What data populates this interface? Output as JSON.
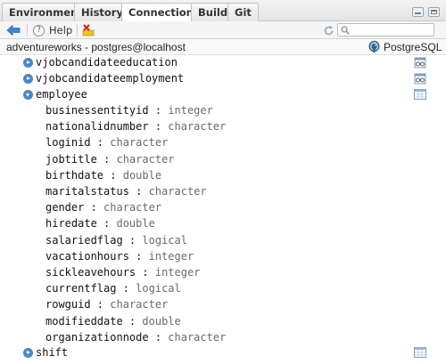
{
  "tabs": [
    "Environment",
    "History",
    "Connections",
    "Build",
    "Git"
  ],
  "toolbar": {
    "help_label": "Help",
    "search_placeholder": ""
  },
  "connection": {
    "title": "adventureworks - postgres@localhost",
    "db_label": "PostgreSQL"
  },
  "tree": {
    "views": [
      "vjobcandidateeducation",
      "vjobcandidateemployment"
    ],
    "expanded_table": "employee",
    "fields": [
      {
        "name": "businessentityid",
        "type": "integer"
      },
      {
        "name": "nationalidnumber",
        "type": "character"
      },
      {
        "name": "loginid",
        "type": "character"
      },
      {
        "name": "jobtitle",
        "type": "character"
      },
      {
        "name": "birthdate",
        "type": "double"
      },
      {
        "name": "maritalstatus",
        "type": "character"
      },
      {
        "name": "gender",
        "type": "character"
      },
      {
        "name": "hiredate",
        "type": "double"
      },
      {
        "name": "salariedflag",
        "type": "logical"
      },
      {
        "name": "vacationhours",
        "type": "integer"
      },
      {
        "name": "sickleavehours",
        "type": "integer"
      },
      {
        "name": "currentflag",
        "type": "logical"
      },
      {
        "name": "rowguid",
        "type": "character"
      },
      {
        "name": "modifieddate",
        "type": "double"
      },
      {
        "name": "organizationnode",
        "type": "character"
      }
    ],
    "next_table": "shift"
  },
  "colors": {
    "toggle": "#4a86c8",
    "type_text": "#6a6a6a"
  }
}
